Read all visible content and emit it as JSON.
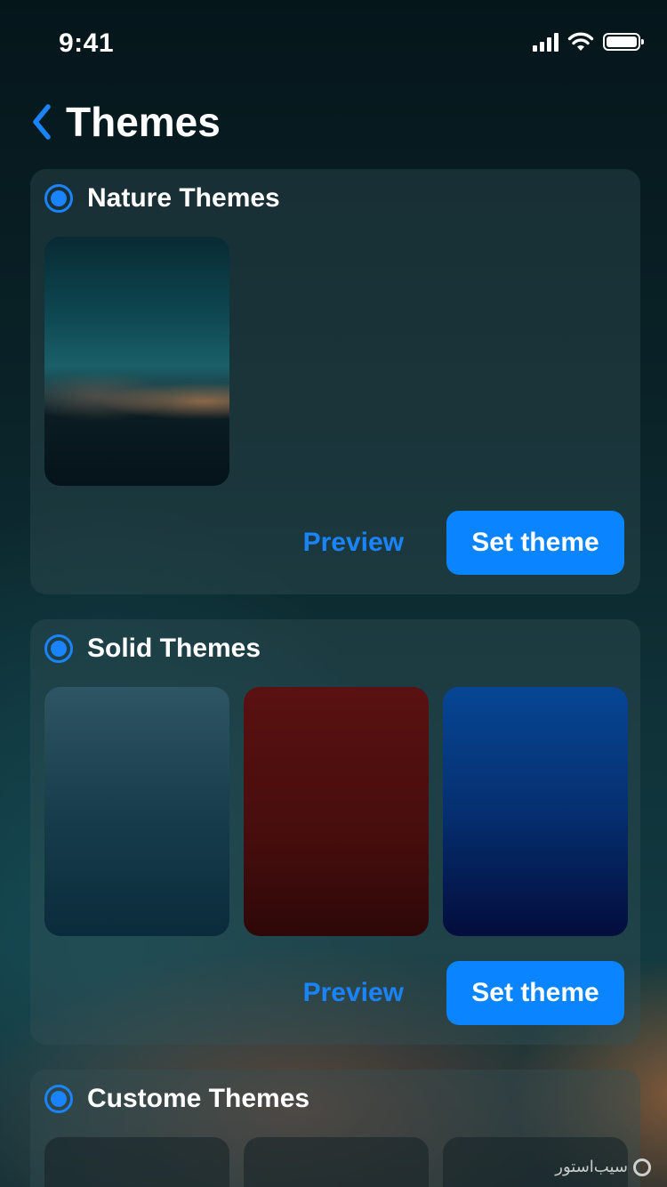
{
  "status_bar": {
    "time": "9:41"
  },
  "nav": {
    "title": "Themes"
  },
  "sections": [
    {
      "title": "Nature Themes",
      "selected": true,
      "preview_label": "Preview",
      "set_label": "Set theme"
    },
    {
      "title": "Solid Themes",
      "selected": true,
      "preview_label": "Preview",
      "set_label": "Set theme"
    },
    {
      "title": "Custome Themes",
      "selected": true
    }
  ],
  "colors": {
    "accent": "#0a84ff",
    "card_bg": "#2a4a50",
    "solid_1": "#1f4654",
    "solid_2": "#4d0e0e",
    "solid_3": "#052f70"
  },
  "watermark": {
    "text": "سیب‌استور"
  },
  "icons": [
    "cellular-signal-icon",
    "wifi-icon",
    "battery-icon",
    "chevron-left-icon"
  ]
}
